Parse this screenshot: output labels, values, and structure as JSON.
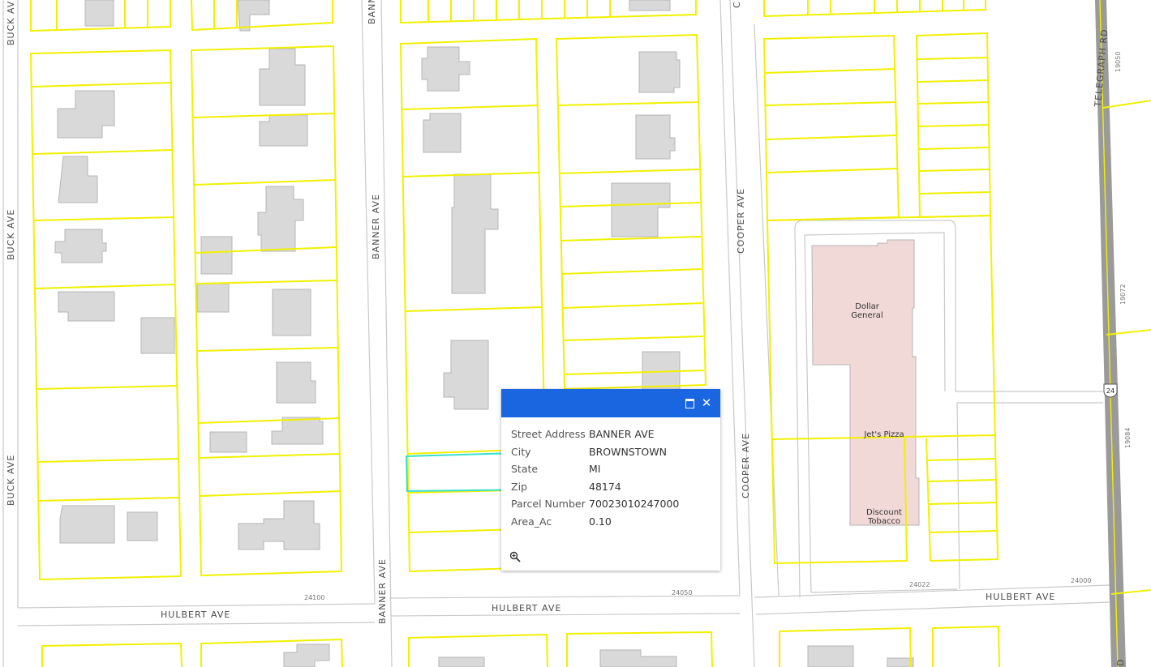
{
  "streets": {
    "buck_1": "BUCK AVE",
    "buck_2": "BUCK AVE",
    "buck_3": "BUCK AVE",
    "banner_top": "BANN",
    "banner_mid": "BANNER AVE",
    "banner_bottom": "BANNER AVE",
    "cooper_top": "C",
    "cooper_mid": "COOPER AVE",
    "cooper_bottom": "COOPER AVE",
    "telegraph_top": "TELEGRAPH RD",
    "telegraph_bottom": "D",
    "hulbert_1": "HULBERT AVE",
    "hulbert_2": "HULBERT AVE",
    "hulbert_3": "HULBERT AVE"
  },
  "address_numbers": {
    "a1": "24100",
    "a2": "24050",
    "a3": "24022",
    "a4": "24000",
    "a5": "19050",
    "a6": "19072",
    "a7": "19084"
  },
  "route_shield": "24",
  "businesses": {
    "dollar_1": "Dollar",
    "dollar_2": "General",
    "jets": "Jet's Pizza",
    "discount_1": "Discount",
    "discount_2": "Tobacco"
  },
  "popup": {
    "maximize_icon": "maximize-icon",
    "close_icon": "close-icon",
    "close_glyph": "✕",
    "zoom_icon": "zoom-to-icon",
    "fields": [
      {
        "label": "Street Address",
        "value": "BANNER AVE"
      },
      {
        "label": "City",
        "value": "BROWNSTOWN"
      },
      {
        "label": "State",
        "value": "MI"
      },
      {
        "label": "Zip",
        "value": "48174"
      },
      {
        "label": "Parcel Number",
        "value": "70023010247000"
      },
      {
        "label": "Area_Ac",
        "value": "0.10"
      }
    ]
  },
  "colors": {
    "parcel_line": "#f2f000",
    "building_fill": "#d9d9d9",
    "commercial_fill": "#f0d9d6",
    "road_edge": "#c8c8c8",
    "highway": "#9a9a9a",
    "popup_header": "#1a66e0",
    "selected_parcel": "#35e0d0"
  }
}
